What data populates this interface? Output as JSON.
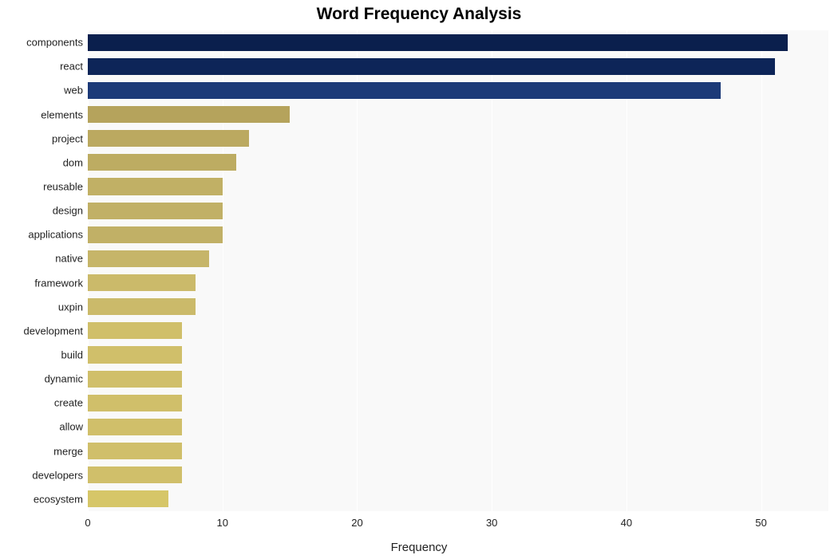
{
  "chart_data": {
    "type": "bar",
    "orientation": "horizontal",
    "title": "Word Frequency Analysis",
    "xlabel": "Frequency",
    "ylabel": "",
    "xlim": [
      0,
      55
    ],
    "xticks": [
      0,
      10,
      20,
      30,
      40,
      50
    ],
    "categories": [
      "components",
      "react",
      "web",
      "elements",
      "project",
      "dom",
      "reusable",
      "design",
      "applications",
      "native",
      "framework",
      "uxpin",
      "development",
      "build",
      "dynamic",
      "create",
      "allow",
      "merge",
      "developers",
      "ecosystem"
    ],
    "values": [
      52,
      51,
      47,
      15,
      12,
      11,
      10,
      10,
      10,
      9,
      8,
      8,
      7,
      7,
      7,
      7,
      7,
      7,
      7,
      6
    ],
    "colors": [
      "#0a1f4d",
      "#0d2558",
      "#1c3a78",
      "#b5a35c",
      "#bba960",
      "#bdac62",
      "#c1b065",
      "#c1b066",
      "#c1b066",
      "#c6b569",
      "#cbba6a",
      "#cbba6a",
      "#d0bf6a",
      "#d0bf6a",
      "#d0bf6a",
      "#d0bf6a",
      "#d0bf6a",
      "#d0bf6a",
      "#d0bf6a",
      "#d6c668"
    ],
    "grid": true
  }
}
